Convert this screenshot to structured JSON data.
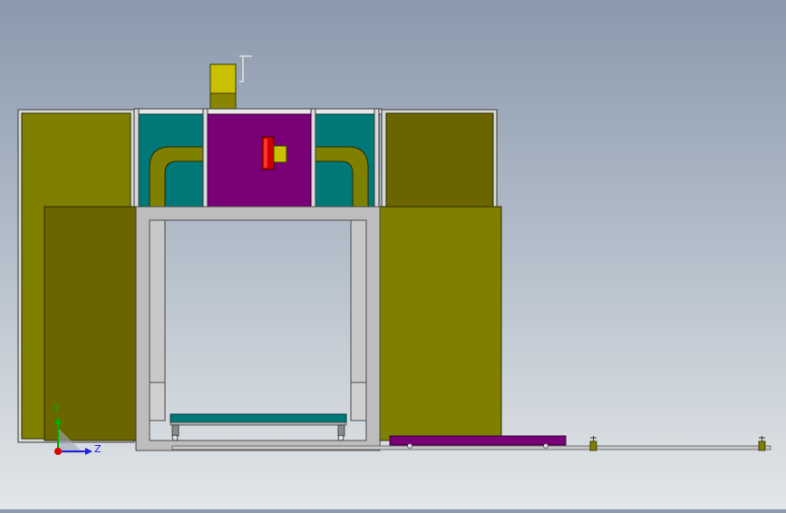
{
  "viewport": {
    "background_top": "#8a99ad",
    "background_bottom": "#e3e6e8"
  },
  "colors": {
    "olive": "#808000",
    "olive_dark": "#6b6500",
    "teal": "#007878",
    "purple": "#7a0078",
    "frame_gray": "#bdbdbd",
    "frame_edge": "#5a5a5a",
    "red": "#c80000",
    "yellow_knob": "#c8c000",
    "rail": "#c8c8c8"
  },
  "triad": {
    "y_label": "Y",
    "z_label": "Z",
    "y_color": "#00b000",
    "z_color": "#2020e0",
    "x_color": "#e00000"
  }
}
